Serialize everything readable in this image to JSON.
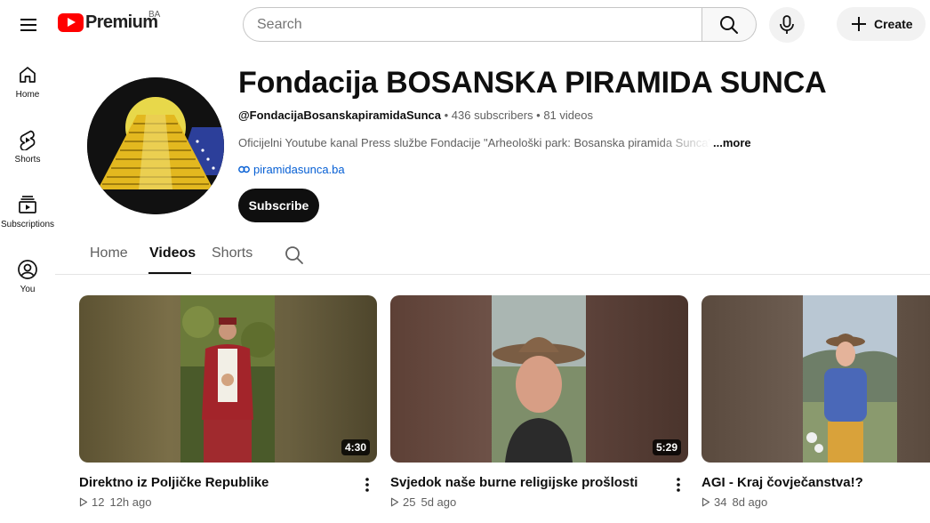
{
  "app": {
    "logo_text": "Premium",
    "country_code": "BA"
  },
  "search": {
    "placeholder": "Search"
  },
  "header": {
    "create_label": "Create"
  },
  "sidebar": {
    "items": [
      {
        "label": "Home",
        "icon": "home-icon"
      },
      {
        "label": "Shorts",
        "icon": "shorts-icon"
      },
      {
        "label": "Subscriptions",
        "icon": "subscriptions-icon"
      },
      {
        "label": "You",
        "icon": "you-icon"
      }
    ]
  },
  "channel": {
    "title": "Fondacija BOSANSKA PIRAMIDA SUNCA",
    "handle": "@FondacijaBosanskapiramidaSunca",
    "subscribers": "436 subscribers",
    "videos_count": "81 videos",
    "separator": " • ",
    "description": "Oficijelni Youtube kanal Press službe Fondacije \"Arheološki park: Bosanska piramida Sunca\"",
    "more_label": "...more",
    "link": "piramidasunca.ba",
    "subscribe_label": "Subscribe"
  },
  "tabs": [
    {
      "label": "Home",
      "active": false
    },
    {
      "label": "Videos",
      "active": true
    },
    {
      "label": "Shorts",
      "active": false
    }
  ],
  "videos": [
    {
      "title": "Direktno iz Poljičke Republike",
      "duration": "4:30",
      "views": "12",
      "age": "12h ago"
    },
    {
      "title": "Svjedok naše burne religijske prošlosti",
      "duration": "5:29",
      "views": "25",
      "age": "5d ago"
    },
    {
      "title": "AGI - Kraj čovječanstva!?",
      "duration": "",
      "views": "34",
      "age": "8d ago"
    }
  ],
  "colors": {
    "brand_red": "#ff0000",
    "link_blue": "#065fd4",
    "text_primary": "#0f0f0f",
    "text_secondary": "#606060"
  }
}
